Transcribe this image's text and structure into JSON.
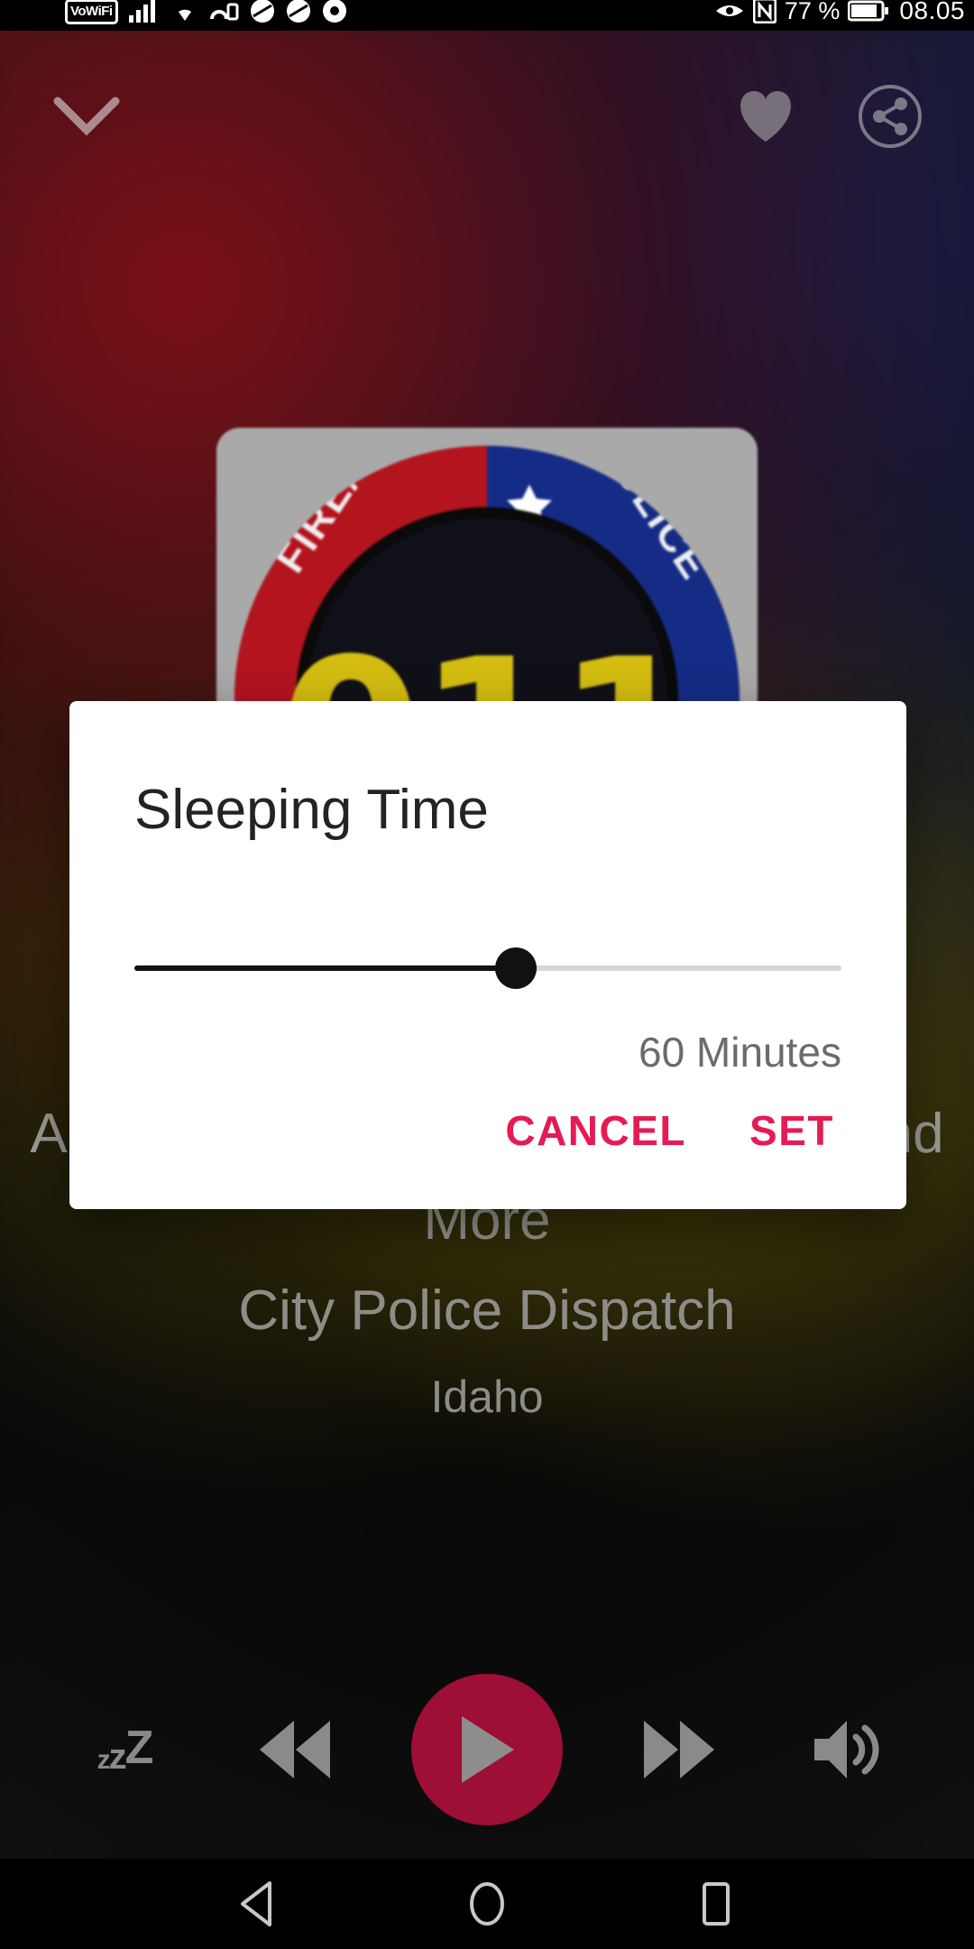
{
  "statusbar": {
    "vowifi_label": "VoWiFi",
    "icons_left": [
      "vowifi-icon",
      "signal-bars-icon",
      "wifi-icon",
      "cast-icon",
      "app-icon-1",
      "app-icon-2",
      "chrome-icon"
    ],
    "icons_right": [
      "eye-icon",
      "nfc-icon",
      "battery-icon"
    ],
    "battery_percent": "77 %",
    "time": "08.05"
  },
  "player": {
    "collapse_icon": "chevron-down-icon",
    "favorite_icon": "heart-icon",
    "share_icon": "share-icon",
    "artwork": {
      "name": "station-artwork",
      "badge_number": "011",
      "arc_left_text": "FIRE/EMS",
      "arc_right_text": "POLICE",
      "star_icon": "seven-point-star-icon"
    },
    "track": {
      "line1": "Ada County Fire Police Dispatch and More",
      "line2": "City Police Dispatch",
      "line3": "Idaho"
    },
    "controls": {
      "sleep_label": "zZz",
      "sleep_icon": "sleep-timer-icon",
      "rewind_icon": "rewind-icon",
      "play_icon": "play-icon",
      "forward_icon": "fast-forward-icon",
      "volume_icon": "volume-icon",
      "play_button_color": "#9d0f35"
    }
  },
  "dialog": {
    "title": "Sleeping Time",
    "slider": {
      "value_label": "60 Minutes",
      "value": 60,
      "min": 0,
      "max": 111,
      "percent": 54
    },
    "cancel_label": "CANCEL",
    "set_label": "SET",
    "accent_color": "#e51b53"
  },
  "navbar": {
    "back_icon": "back-triangle-icon",
    "home_icon": "home-circle-icon",
    "recents_icon": "recents-square-icon"
  }
}
